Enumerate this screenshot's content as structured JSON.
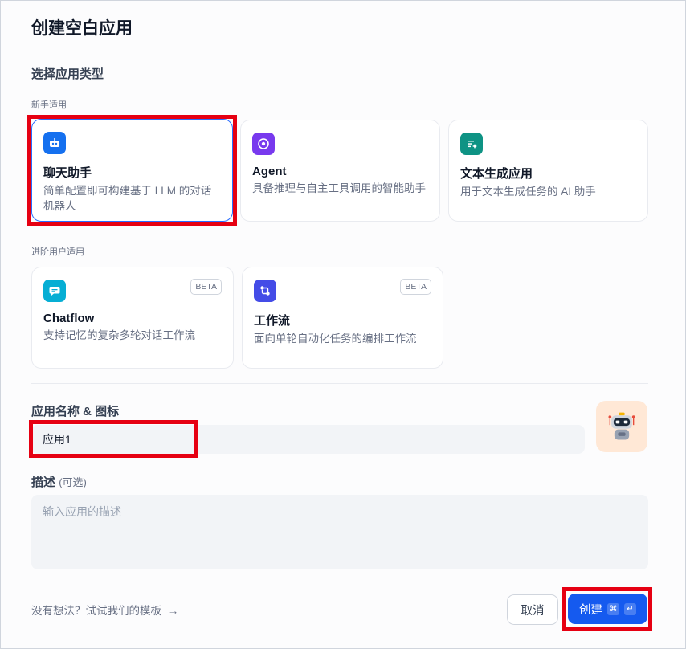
{
  "dialog": {
    "title": "创建空白应用"
  },
  "app_type": {
    "section_label": "选择应用类型",
    "beginner_label": "新手适用",
    "advanced_label": "进阶用户适用",
    "types": [
      {
        "name": "聊天助手",
        "desc": "简单配置即可构建基于 LLM 的对话机器人",
        "icon": "chat-bot-icon",
        "color": "#1570ef",
        "selected": true
      },
      {
        "name": "Agent",
        "desc": "具备推理与自主工具调用的智能助手",
        "icon": "agent-icon",
        "color": "#7839ee"
      },
      {
        "name": "文本生成应用",
        "desc": "用于文本生成任务的 AI 助手",
        "icon": "text-generation-icon",
        "color": "#0e9384"
      },
      {
        "name": "Chatflow",
        "desc": "支持记忆的复杂多轮对话工作流",
        "icon": "chatflow-icon",
        "color": "#06aed4",
        "badge": "BETA"
      },
      {
        "name": "工作流",
        "desc": "面向单轮自动化任务的编排工作流",
        "icon": "workflow-icon",
        "color": "#444ce7",
        "badge": "BETA"
      }
    ]
  },
  "name_field": {
    "label": "应用名称 & 图标",
    "value": "应用1",
    "avatar_icon": "robot-avatar-icon"
  },
  "desc_field": {
    "label": "描述",
    "optional": "(可选)",
    "placeholder": "输入应用的描述"
  },
  "footer": {
    "templates_link": "没有想法？试试我们的模板",
    "arrow": "→",
    "cancel_label": "取消",
    "create_label": "创建",
    "shortcut_cmd": "⌘",
    "shortcut_enter": "↵"
  },
  "highlight_color": "#e60012"
}
